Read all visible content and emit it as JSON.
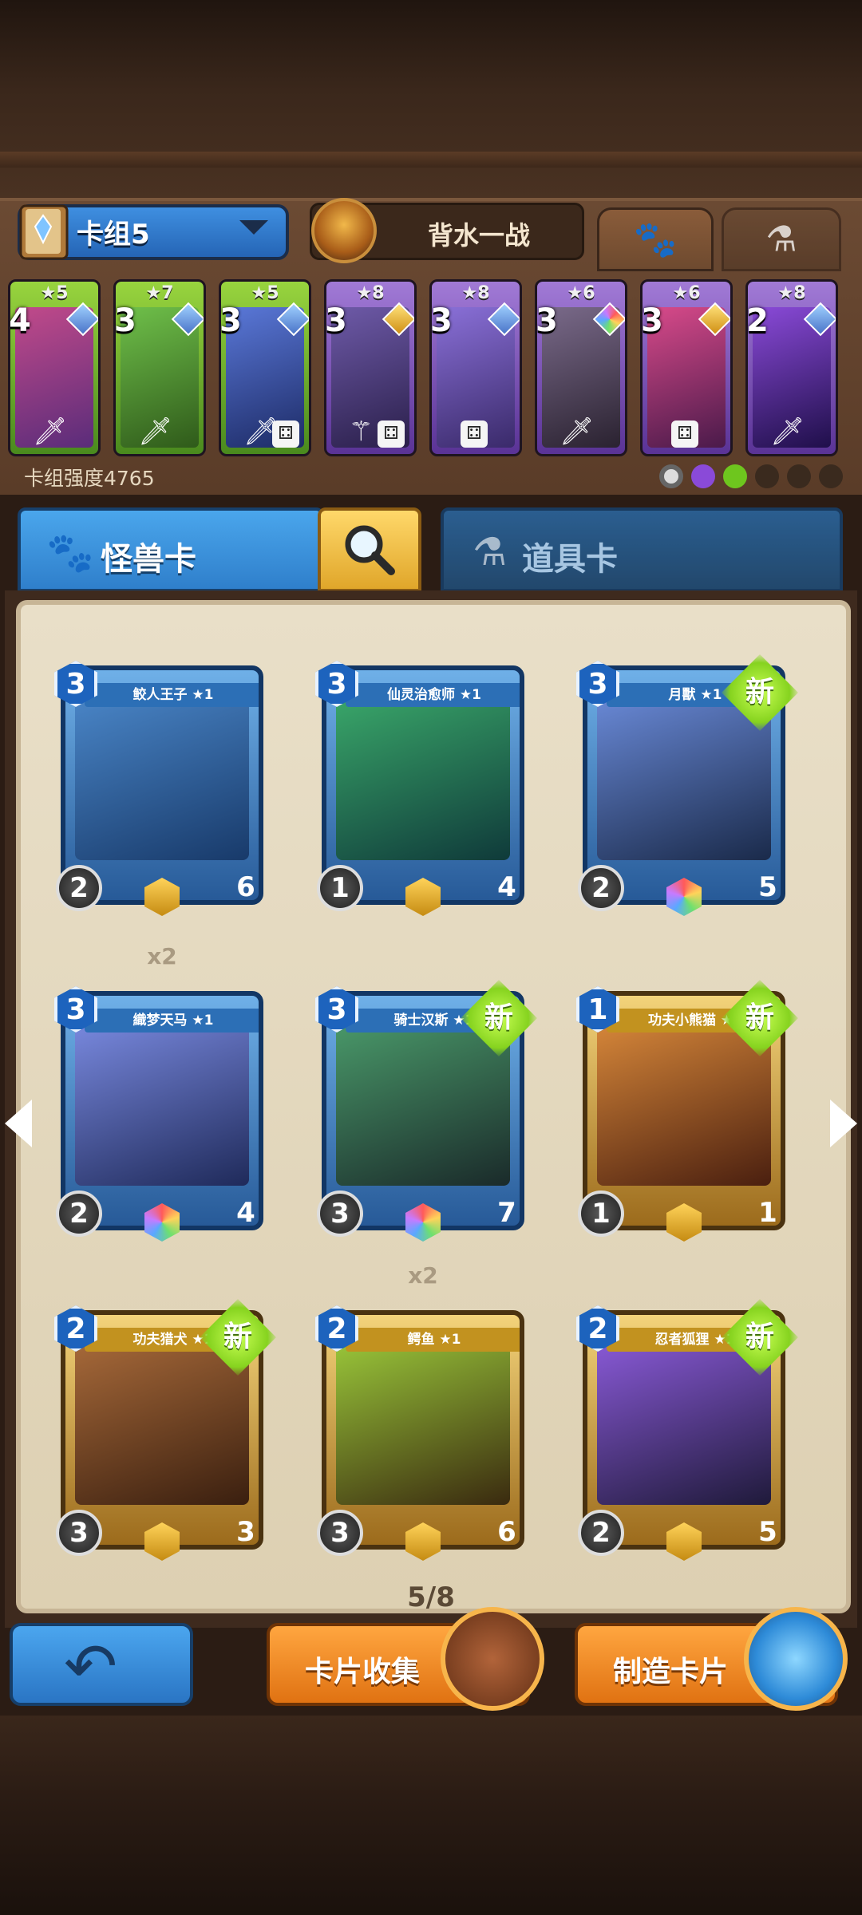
{
  "header": {
    "deck_name": "卡组5",
    "hero_name": "背水一战",
    "tabs": [
      "paw-icon",
      "potion-icon"
    ]
  },
  "deck": {
    "power_label": "卡组强度4765",
    "cards": [
      {
        "stars": "★5",
        "cost": "4",
        "rarity": "green"
      },
      {
        "stars": "★7",
        "cost": "3",
        "rarity": "green"
      },
      {
        "stars": "★5",
        "cost": "3",
        "rarity": "green"
      },
      {
        "stars": "★8",
        "cost": "3",
        "rarity": "purple"
      },
      {
        "stars": "★8",
        "cost": "3",
        "rarity": "purple"
      },
      {
        "stars": "★6",
        "cost": "3",
        "rarity": "purple"
      },
      {
        "stars": "★6",
        "cost": "3",
        "rarity": "purple"
      },
      {
        "stars": "★8",
        "cost": "2",
        "rarity": "purple"
      }
    ]
  },
  "category_tabs": {
    "monster": "怪兽卡",
    "item": "道具卡"
  },
  "collection": {
    "page": "5/8",
    "cards": [
      {
        "title": "鲛人王子 ★1",
        "cost": "3",
        "atk": "2",
        "hp": "6",
        "new": "",
        "dup": ""
      },
      {
        "title": "仙灵治愈师 ★1",
        "cost": "3",
        "atk": "1",
        "hp": "4",
        "new": "",
        "dup": ""
      },
      {
        "title": "月獸 ★1",
        "cost": "3",
        "atk": "2",
        "hp": "5",
        "new": "新",
        "dup": ""
      },
      {
        "title": "織梦天马 ★1",
        "cost": "3",
        "atk": "2",
        "hp": "4",
        "new": "",
        "dup": "x2"
      },
      {
        "title": "骑士汉斯 ★1",
        "cost": "3",
        "atk": "3",
        "hp": "7",
        "new": "新",
        "dup": ""
      },
      {
        "title": "功夫小熊猫 ★1",
        "cost": "1",
        "atk": "1",
        "hp": "1",
        "new": "新",
        "dup": ""
      },
      {
        "title": "功夫猎犬 ★1",
        "cost": "2",
        "atk": "3",
        "hp": "3",
        "new": "新",
        "dup": ""
      },
      {
        "title": "鳄鱼 ★1",
        "cost": "2",
        "atk": "3",
        "hp": "6",
        "new": "",
        "dup": "x2"
      },
      {
        "title": "忍者狐狸 ★1",
        "cost": "2",
        "atk": "2",
        "hp": "5",
        "new": "新",
        "dup": ""
      }
    ]
  },
  "buttons": {
    "collect": "卡片收集",
    "craft": "制造卡片"
  },
  "colors": {
    "blue_card": "#2c6fb6",
    "gold_card": "#c2921f",
    "new_badge": "#86d31f",
    "orange_button": "#e07212"
  }
}
